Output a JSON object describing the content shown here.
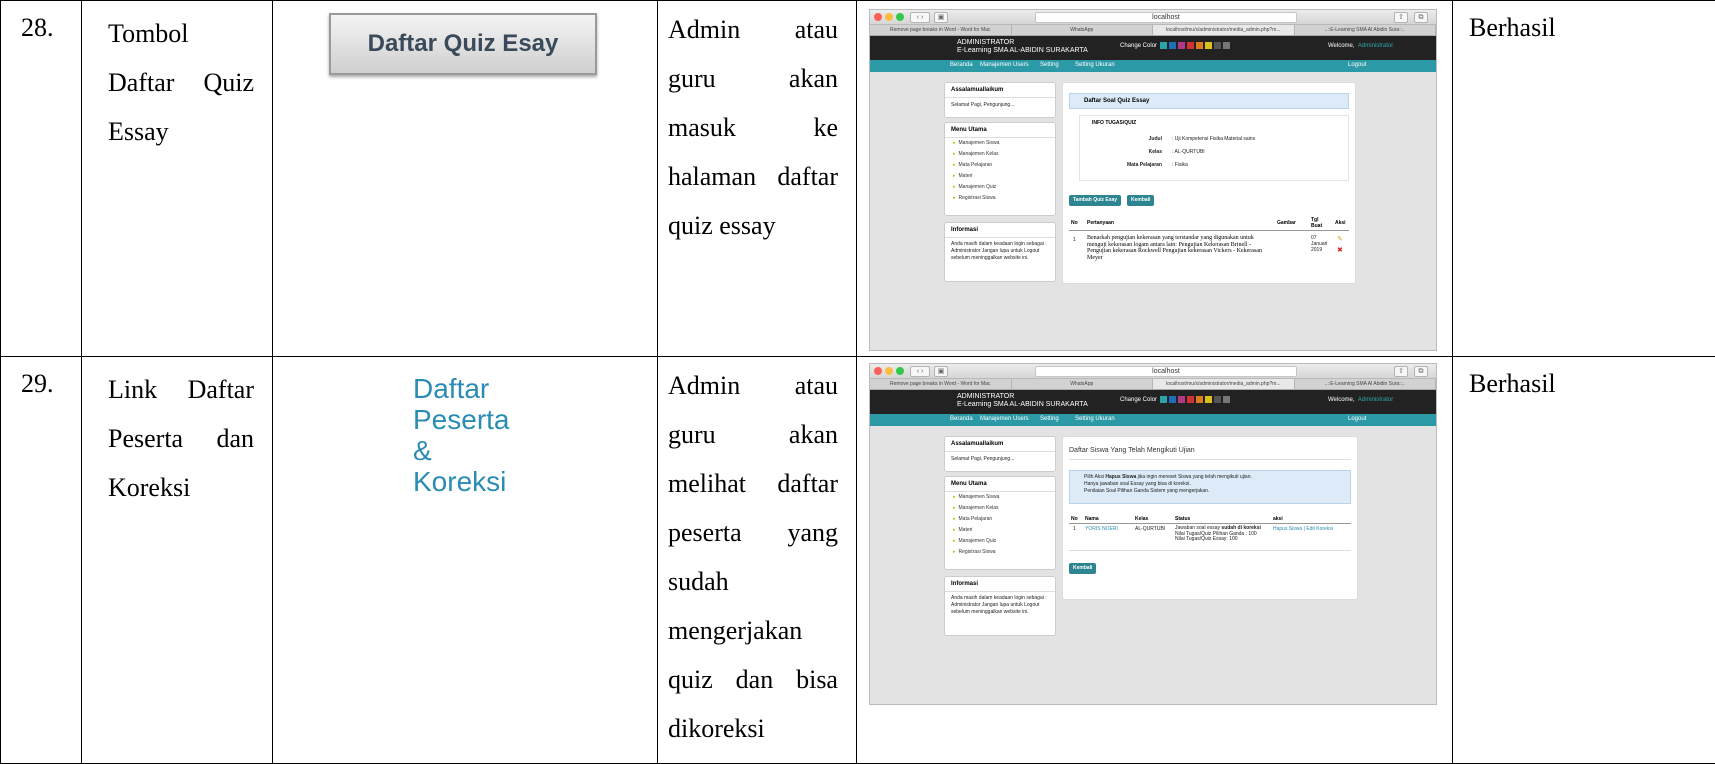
{
  "rows": [
    {
      "no": "28.",
      "name_lines": [
        [
          "Tombol"
        ],
        [
          "Daftar",
          "Quiz"
        ],
        [
          "Essay"
        ]
      ],
      "image_label": "Daftar Quiz Esay",
      "desc_lines": [
        [
          "Admin",
          "atau"
        ],
        [
          "guru",
          "akan"
        ],
        [
          "masuk",
          "ke"
        ],
        [
          "halaman",
          "daftar"
        ],
        [
          "quiz essay"
        ]
      ],
      "result": "Berhasil",
      "screenshot": {
        "url": "localhost",
        "tabs": [
          "Remove page breaks in Word - Word for Mac",
          "WhatsApp",
          "localhost/mu/s/administrator/media_admin.php?m...",
          "..::E-Learning SMA Al Abidin Sura::.."
        ],
        "brand_top": "ADMINISTRATOR",
        "brand_bottom": "E-Learning SMA AL-ABIDIN SURAKARTA",
        "change_color": "Change Color",
        "welcome": "Welcome,",
        "welcome_user": "Administrator",
        "nav": [
          "Beranda",
          "Manajemen Users",
          "Setting",
          "Setting Ukuran",
          "Logout"
        ],
        "side_greet_title": "Assalamuallaikum",
        "side_greet_text": "Selamat Pagi, Pengunjung...",
        "side_menu_title": "Menu Utama",
        "side_menu_items": [
          "Manajemen Siswa",
          "Manajemen Kelas",
          "Mata Pelajaran",
          "Materi",
          "Manajemen Quiz",
          "Registrasi Siswa"
        ],
        "side_info_title": "Informasi",
        "side_info_text": "Anda masih dalam keadaan login sebagai : Administrator Jangan lupa untuk Logout sebelum meninggalkan website ini.",
        "main_title": "Daftar Soal Quiz Essay",
        "info_title": "INFO TUGAS/QUIZ",
        "info_fields": [
          {
            "label": "Judul",
            "value": ": Uji Kompetensi Fisika Material sains"
          },
          {
            "label": "Kelas",
            "value": ": AL-QURTUBI"
          },
          {
            "label": "Mata Pelajaran",
            "value": ": Fisika"
          }
        ],
        "btn_add": "Tambah Quiz Esay",
        "btn_back": "Kembali",
        "table_headers": [
          "No",
          "Pertanyaan",
          "Gambar",
          "Tgl Buat",
          "Aksi"
        ],
        "table_row": {
          "no": "1",
          "question": "Benarkah pengujian kekerasan yang terstandar yang digunakan untuk menguji kekerasan logam antara lain: Pengujian Kekerasan Brinell - Pengujian kekerasan Rockwell Pengujian kekerasan Vickers - Kekerasan Meyer",
          "date": "07 Januari 2019"
        }
      }
    },
    {
      "no": "29.",
      "name_lines": [
        [
          "Link",
          "Daftar"
        ],
        [
          "Peserta",
          "dan"
        ],
        [
          "Koreksi"
        ]
      ],
      "image_lines": [
        "Daftar",
        "Peserta",
        "&",
        "Koreksi"
      ],
      "desc_lines": [
        [
          "Admin",
          "atau"
        ],
        [
          "guru",
          "akan"
        ],
        [
          "melihat",
          "daftar"
        ],
        [
          "peserta",
          "yang"
        ],
        [
          "sudah"
        ],
        [
          "mengerjakan"
        ],
        [
          "quiz",
          "dan",
          "bisa"
        ],
        [
          "dikoreksi"
        ]
      ],
      "result": "Berhasil",
      "screenshot": {
        "url": "localhost",
        "main_title": "Daftar Siswa Yang Telah Mengikuti Ujian",
        "info_text_1a": "Pilih Aksi ",
        "info_text_1b": "Hapus Siswa",
        "info_text_1c": " jika ingin mereset Siswa yang telah mengikuti ujian.",
        "info_text_2": "Hanya jawaban soal Essay yang bisa di koreksi.",
        "info_text_3": "Penilaian Soal Pilihan Ganda Sistem yang mengerjakan.",
        "table_headers": [
          "No",
          "Nama",
          "Kelas",
          "Status",
          "aksi"
        ],
        "table_row": {
          "no": "1",
          "nama": "YORIS NOERI",
          "kelas": "AL-QURTUBI",
          "status_1a": "Jawaban soal essay ",
          "status_1b": "sudah di koreksi",
          "status_2": "Nilai Tugas/Quiz Pilihan Ganda : 100",
          "status_3": "Nilai Tugas/Quiz Essay: 100",
          "aksi": "Hapus Siswa | Edit Koreksi"
        },
        "btn_back": "Kembali"
      }
    }
  ],
  "colors": {
    "teal_nav": "#2c9aa6",
    "dark_header": "#222222",
    "link_blue": "#2b8cb3"
  }
}
